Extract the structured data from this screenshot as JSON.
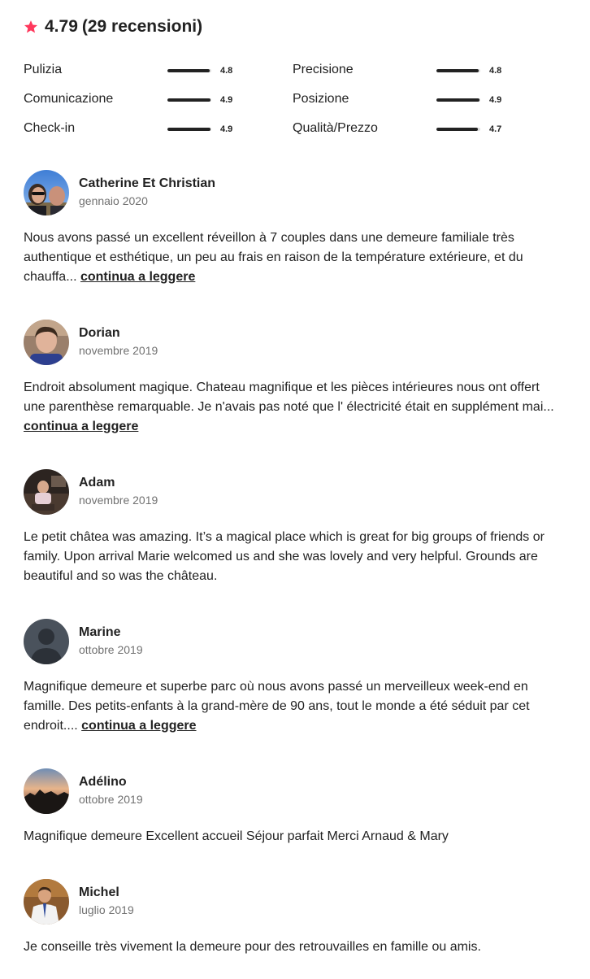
{
  "summary": {
    "rating": "4.79",
    "count": "(29 recensioni)",
    "accent_color": "#FF385C"
  },
  "categories": [
    {
      "label": "Pulizia",
      "value": "4.8",
      "fill": 0.96
    },
    {
      "label": "Precisione",
      "value": "4.8",
      "fill": 0.96
    },
    {
      "label": "Comunicazione",
      "value": "4.9",
      "fill": 0.98
    },
    {
      "label": "Posizione",
      "value": "4.9",
      "fill": 0.98
    },
    {
      "label": "Check-in",
      "value": "4.9",
      "fill": 0.98
    },
    {
      "label": "Qualità/Prezzo",
      "value": "4.7",
      "fill": 0.94
    }
  ],
  "reviews": [
    {
      "name": "Catherine Et Christian",
      "date": "gennaio 2020",
      "text": "Nous avons passé un excellent réveillon à 7 couples dans une demeure familiale très authentique et esthétique, un peu au frais en raison de la température extérieure, et du chauffa...",
      "read_more": "continua a leggere"
    },
    {
      "name": "Dorian",
      "date": "novembre 2019",
      "text": "Endroit absolument magique. Chateau magnifique et les pièces intérieures nous ont offert une parenthèse remarquable. Je n'avais pas noté que l' électricité était en supplément mai...",
      "read_more": "continua a leggere"
    },
    {
      "name": "Adam",
      "date": "novembre 2019",
      "text": "Le petit châtea was amazing. It’s a magical place which is great for big groups of friends or family. Upon arrival Marie welcomed us and she was lovely and very helpful. Grounds are beautiful and so was the château.",
      "read_more": ""
    },
    {
      "name": "Marine",
      "date": "ottobre 2019",
      "text": "Magnifique demeure et superbe parc où nous avons passé un merveilleux week-end en famille. Des petits-enfants à la grand-mère de 90 ans, tout le monde a été séduit par cet endroit....",
      "read_more": "continua a leggere"
    },
    {
      "name": "Adélino",
      "date": "ottobre 2019",
      "text": "Magnifique demeure Excellent accueil Séjour parfait Merci Arnaud & Mary",
      "read_more": ""
    },
    {
      "name": "Michel",
      "date": "luglio 2019",
      "text": "Je conseille très vivement la demeure pour des retrouvailles en famille ou amis.",
      "read_more": ""
    }
  ]
}
